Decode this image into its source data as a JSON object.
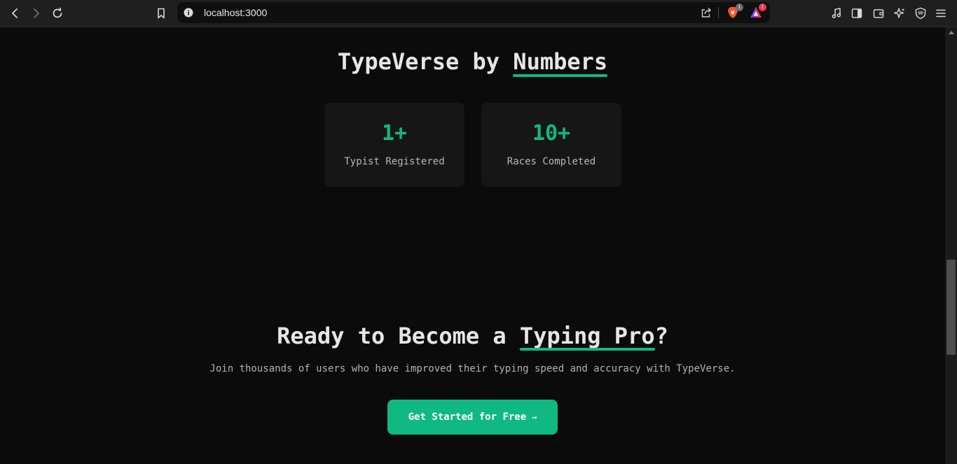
{
  "browser": {
    "url": "localhost:3000",
    "brave_badge": "1",
    "rewards_badge": "1",
    "icons": [
      "back-icon",
      "forward-icon",
      "reload-icon",
      "bookmark-icon",
      "site-info-icon",
      "share-icon",
      "brave-shields-icon",
      "brave-rewards-icon",
      "media-icon",
      "sidebar-icon",
      "wallet-icon",
      "leo-ai-icon",
      "vpn-icon",
      "menu-icon"
    ]
  },
  "stats": {
    "title_prefix": "TypeVerse by ",
    "title_accent": "Numbers",
    "items": [
      {
        "value": "1+",
        "label": "Typist Registered"
      },
      {
        "value": "10+",
        "label": "Races Completed"
      }
    ]
  },
  "cta": {
    "title_prefix": "Ready to Become a ",
    "title_accent": "Typing Pro",
    "title_suffix": "?",
    "subtitle": "Join thousands of users who have improved their typing speed and accuracy with TypeVerse.",
    "button_label": "Get Started for Free",
    "button_arrow": "→"
  },
  "colors": {
    "accent": "#10b981",
    "background": "#0b0b0b",
    "card": "#161616"
  }
}
